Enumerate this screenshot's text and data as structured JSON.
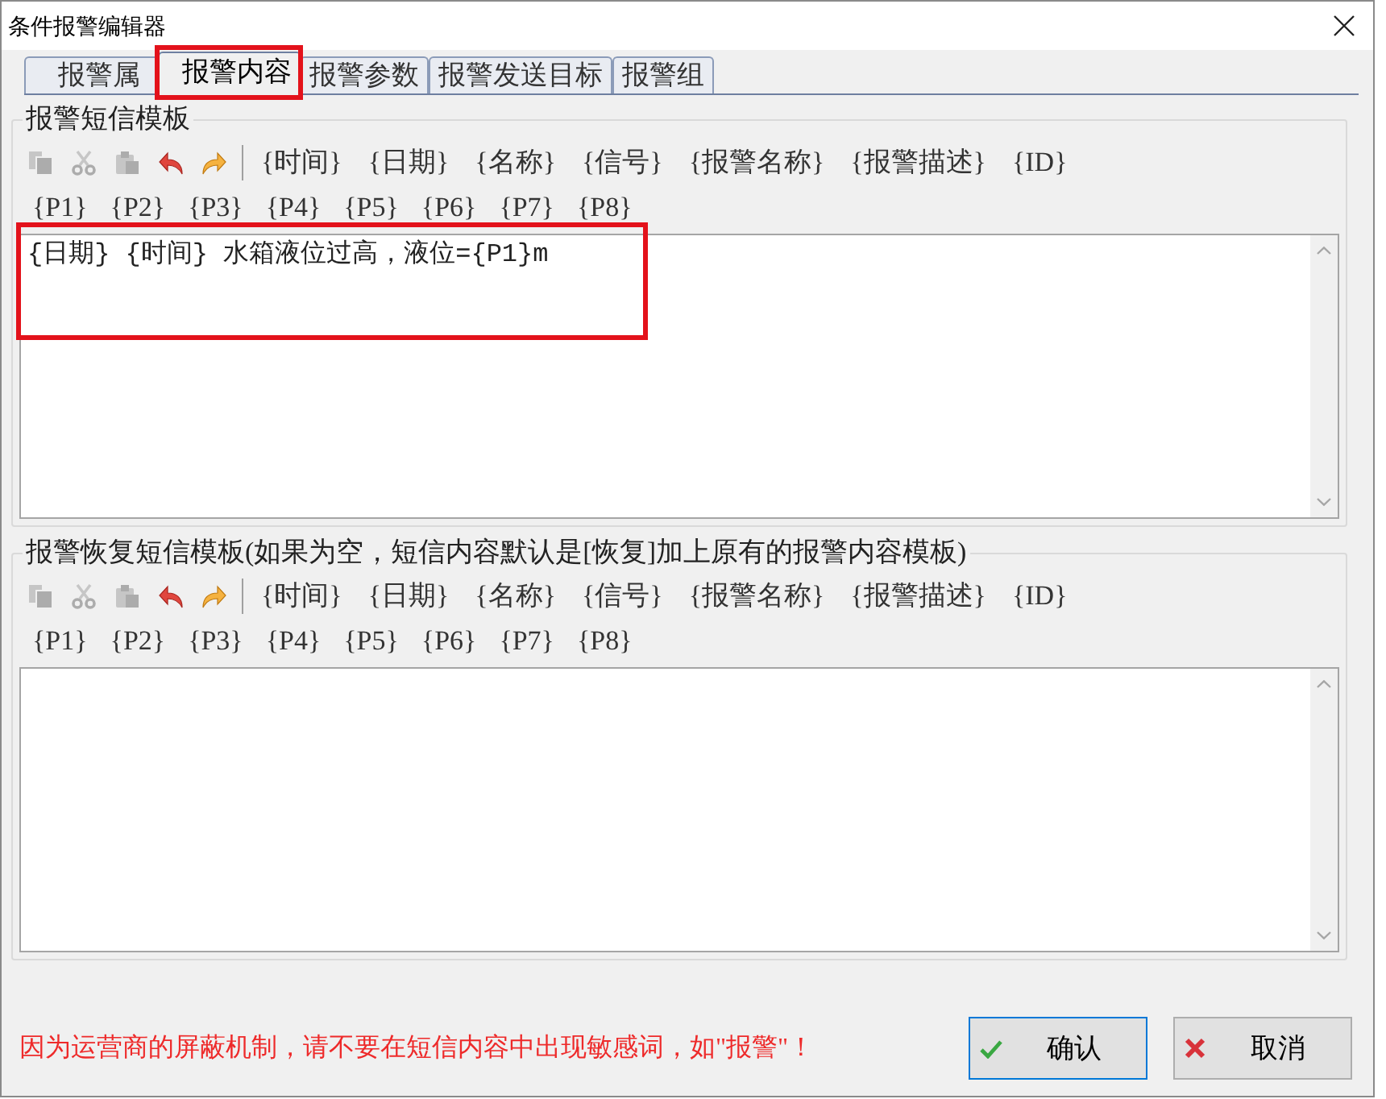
{
  "window": {
    "title": "条件报警编辑器"
  },
  "tabs": [
    {
      "label": "报警属",
      "selected": false,
      "highlighted": false
    },
    {
      "label": "报警内容",
      "selected": true,
      "highlighted": true
    },
    {
      "label": "报警参数",
      "selected": false,
      "highlighted": false
    },
    {
      "label": "报警发送目标",
      "selected": false,
      "highlighted": false
    },
    {
      "label": "报警组",
      "selected": false,
      "highlighted": false
    }
  ],
  "sms_template": {
    "title": "报警短信模板",
    "toolbar": [
      {
        "kind": "copy",
        "disabled": true
      },
      {
        "kind": "cut",
        "disabled": true
      },
      {
        "kind": "paste",
        "disabled": true
      },
      {
        "kind": "undo",
        "disabled": false
      },
      {
        "kind": "redo",
        "disabled": false
      }
    ],
    "token_rows": [
      [
        "{时间}",
        "{日期}",
        "{名称}",
        "{信号}",
        "{报警名称}",
        "{报警描述}",
        "{ID}"
      ],
      [
        "{P1}",
        "{P2}",
        "{P3}",
        "{P4}",
        "{P5}",
        "{P6}",
        "{P7}",
        "{P8}"
      ]
    ],
    "content": "{日期} {时间} 水箱液位过高，液位={P1}m",
    "highlighted": true
  },
  "recovery_template": {
    "title": "报警恢复短信模板(如果为空，短信内容默认是[恢复]加上原有的报警内容模板)",
    "toolbar": [
      {
        "kind": "copy",
        "disabled": true
      },
      {
        "kind": "cut",
        "disabled": true
      },
      {
        "kind": "paste",
        "disabled": true
      },
      {
        "kind": "undo",
        "disabled": false
      },
      {
        "kind": "redo",
        "disabled": false
      }
    ],
    "token_rows": [
      [
        "{时间}",
        "{日期}",
        "{名称}",
        "{信号}",
        "{报警名称}",
        "{报警描述}",
        "{ID}"
      ],
      [
        "{P1}",
        "{P2}",
        "{P3}",
        "{P4}",
        "{P5}",
        "{P6}",
        "{P7}",
        "{P8}"
      ]
    ]
  },
  "warning": "因为运营商的屏蔽机制，请不要在短信内容中出现敏感词，如\"报警\"！",
  "buttons": [
    {
      "label": "确认",
      "kind": "confirm",
      "focused": true
    },
    {
      "label": "取消",
      "kind": "cancel",
      "focused": false
    }
  ]
}
